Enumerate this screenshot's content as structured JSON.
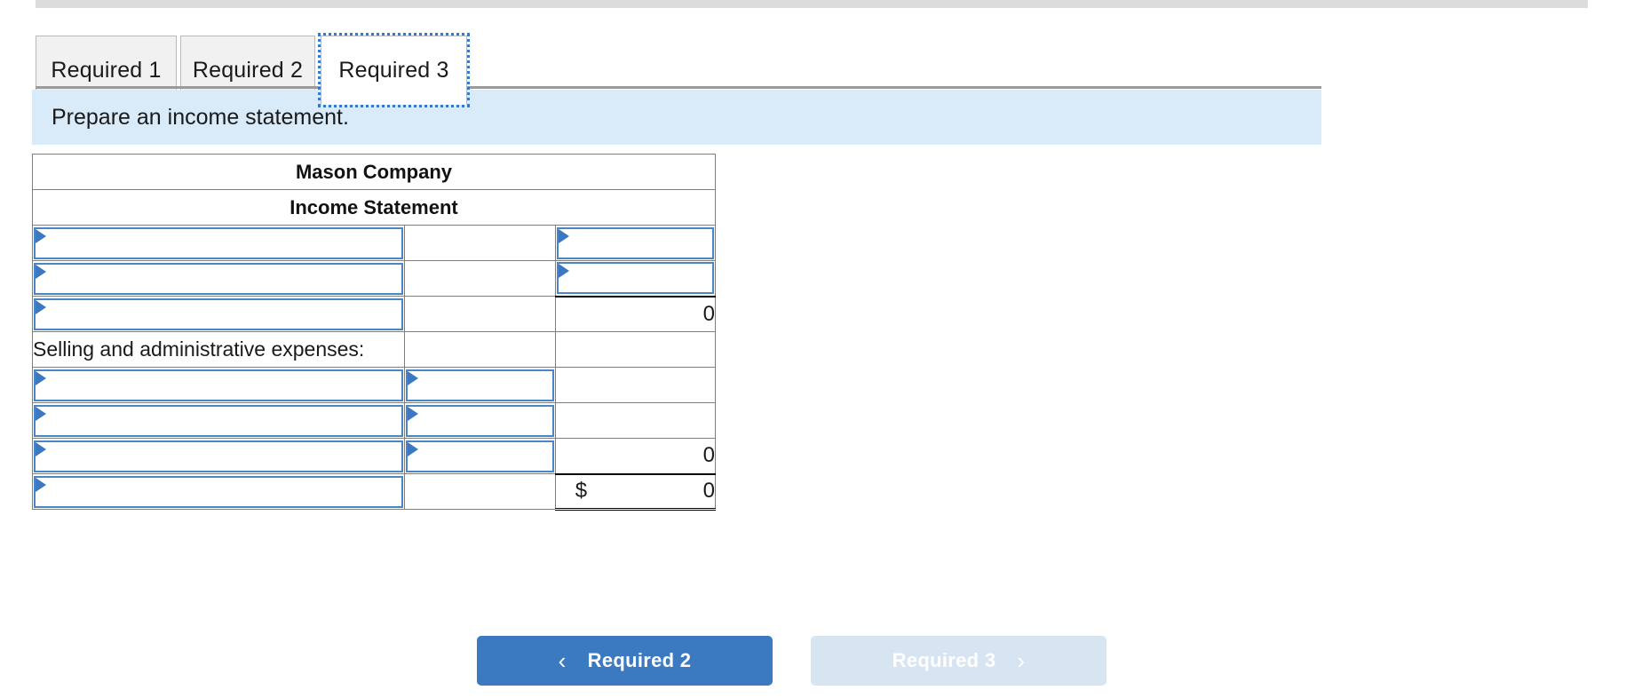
{
  "colors": {
    "header_blue": "#74ace6",
    "banner_blue": "#d9eaf8",
    "accent_blue": "#3b7ac0",
    "input_border": "#4a86c5",
    "disabled_button": "#d7e4f2"
  },
  "tabs": [
    {
      "label": "Required 1",
      "active": false
    },
    {
      "label": "Required 2",
      "active": false
    },
    {
      "label": "Required 3",
      "active": true
    }
  ],
  "instruction": {
    "text": "Prepare an income statement."
  },
  "statement": {
    "company": "Mason Company",
    "title": "Income Statement",
    "rows": [
      {
        "label": "",
        "label_type": "dropdown",
        "mid": "",
        "mid_type": "blank",
        "right": "",
        "right_type": "dropdown"
      },
      {
        "label": "",
        "label_type": "dropdown",
        "mid": "",
        "mid_type": "blank",
        "right": "",
        "right_type": "dropdown",
        "right_rule": "bottom-single"
      },
      {
        "label": "",
        "label_type": "dropdown",
        "mid": "",
        "mid_type": "blank",
        "right": "0",
        "right_type": "value"
      },
      {
        "label": "Selling and administrative expenses:",
        "label_type": "text",
        "mid": "",
        "mid_type": "blank",
        "right": "",
        "right_type": "blank"
      },
      {
        "label": "",
        "label_type": "dropdown",
        "mid": "",
        "mid_type": "dropdown",
        "right": "",
        "right_type": "blank"
      },
      {
        "label": "",
        "label_type": "dropdown",
        "mid": "",
        "mid_type": "dropdown",
        "right": "",
        "right_type": "blank"
      },
      {
        "label": "",
        "label_type": "dropdown",
        "mid": "",
        "mid_type": "dropdown",
        "right": "0",
        "right_type": "value"
      },
      {
        "label": "",
        "label_type": "dropdown",
        "mid": "",
        "mid_type": "blank",
        "right": "0",
        "right_symbol": "$",
        "right_type": "total"
      }
    ]
  },
  "navigation": {
    "prev": {
      "label": "Required 2",
      "icon": "chevron-left-icon",
      "glyph": "‹",
      "enabled": true
    },
    "next": {
      "label": "Required 3",
      "icon": "chevron-right-icon",
      "glyph": "›",
      "enabled": false
    }
  }
}
